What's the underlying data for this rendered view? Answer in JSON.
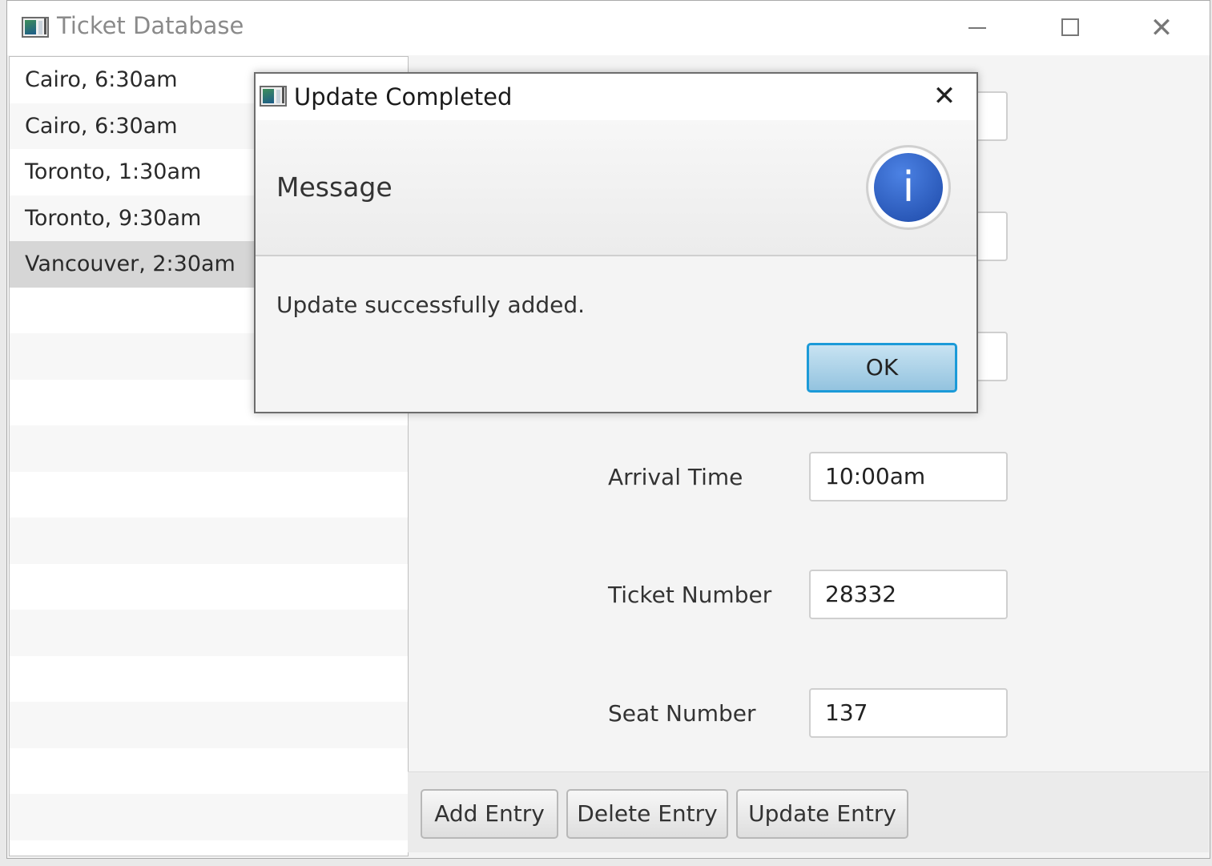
{
  "window": {
    "title": "Ticket Database",
    "controls": {
      "minimize": "minimize-icon",
      "maximize": "maximize-icon",
      "close": "close-icon"
    }
  },
  "list": {
    "items": [
      "Cairo, 6:30am",
      "Cairo, 6:30am",
      "Toronto, 1:30am",
      "Toronto, 9:30am",
      "Vancouver, 2:30am"
    ],
    "selected_index": 4
  },
  "form": {
    "arrival_time_label": "Arrival Time",
    "arrival_time_value": "10:00am",
    "ticket_number_label": "Ticket Number",
    "ticket_number_value": "28332",
    "seat_number_label": "Seat Number",
    "seat_number_value": "137"
  },
  "buttons": {
    "add": "Add Entry",
    "delete": "Delete Entry",
    "update": "Update Entry"
  },
  "dialog": {
    "title": "Update Completed",
    "header": "Message",
    "content": "Update successfully added.",
    "ok": "OK",
    "icon": "info-icon",
    "info_glyph": "i"
  },
  "colors": {
    "selected_row": "#d6d6d6",
    "ok_border": "#1b9ad8",
    "info_icon": "#2d5fc9"
  }
}
